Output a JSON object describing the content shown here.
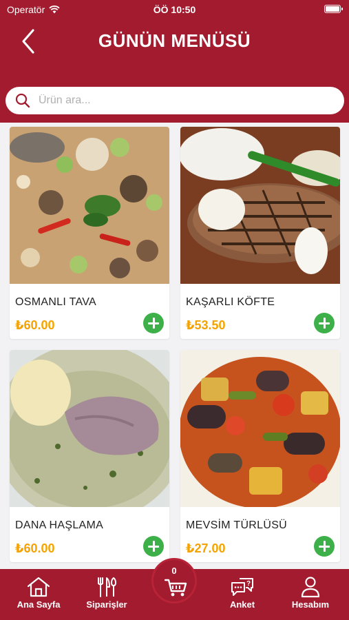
{
  "status_bar": {
    "carrier": "Operatör",
    "time": "ÖÖ 10:50"
  },
  "header": {
    "title": "GÜNÜN MENÜSÜ"
  },
  "search": {
    "placeholder": "Ürün ara..."
  },
  "products": [
    {
      "name": "OSMANLI TAVA",
      "price": "₺60.00"
    },
    {
      "name": "KAŞARLI KÖFTE",
      "price": "₺53.50"
    },
    {
      "name": "DANA HAŞLAMA",
      "price": "₺60.00"
    },
    {
      "name": "MEVSİM TÜRLÜSÜ",
      "price": "₺27.00"
    }
  ],
  "cart": {
    "count": "0"
  },
  "tabbar": {
    "home": "Ana Sayfa",
    "orders": "Siparişler",
    "survey": "Anket",
    "account": "Hesabım"
  },
  "colors": {
    "brand": "#a31b2e",
    "price": "#f4a300",
    "add": "#3eb049"
  }
}
